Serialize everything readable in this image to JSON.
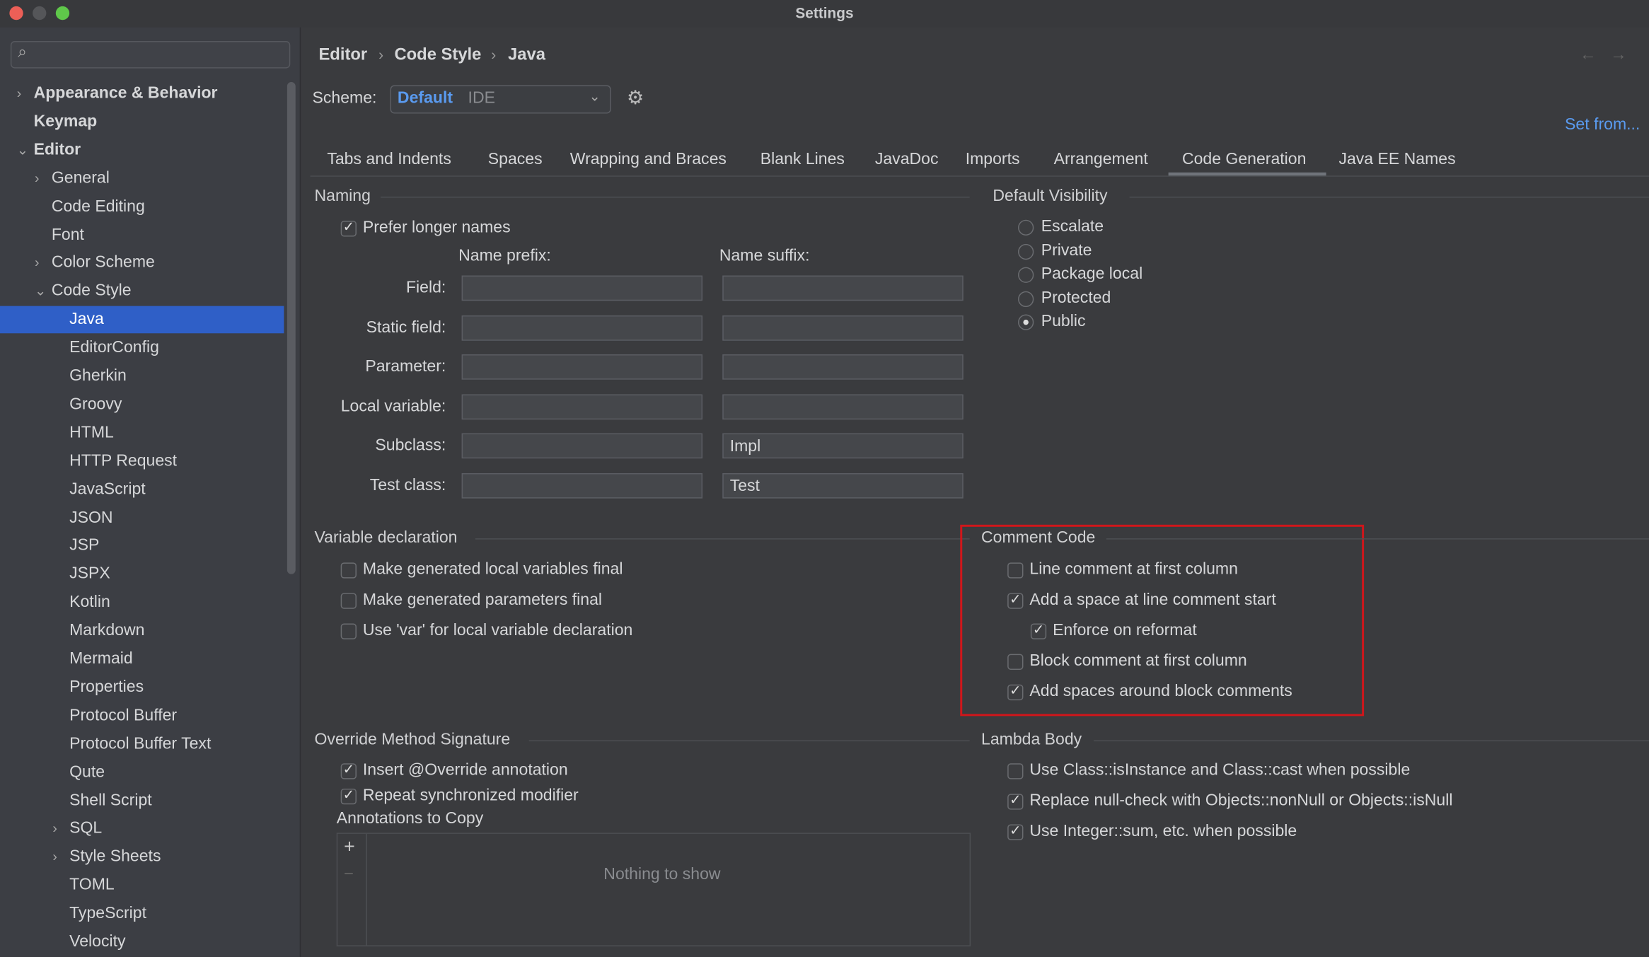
{
  "window": {
    "title": "Settings"
  },
  "search": {
    "placeholder": ""
  },
  "sidebar": {
    "items": [
      {
        "label": "Appearance & Behavior",
        "level": 0,
        "expander": "collapsed",
        "bold": true
      },
      {
        "label": "Keymap",
        "level": 0,
        "expander": "none",
        "bold": true
      },
      {
        "label": "Editor",
        "level": 0,
        "expander": "expanded",
        "bold": true
      },
      {
        "label": "General",
        "level": 1,
        "expander": "collapsed"
      },
      {
        "label": "Code Editing",
        "level": 1,
        "expander": "none"
      },
      {
        "label": "Font",
        "level": 1,
        "expander": "none"
      },
      {
        "label": "Color Scheme",
        "level": 1,
        "expander": "collapsed"
      },
      {
        "label": "Code Style",
        "level": 1,
        "expander": "expanded"
      },
      {
        "label": "Java",
        "level": 2,
        "expander": "none",
        "selected": true
      },
      {
        "label": "EditorConfig",
        "level": 2,
        "expander": "none"
      },
      {
        "label": "Gherkin",
        "level": 2,
        "expander": "none"
      },
      {
        "label": "Groovy",
        "level": 2,
        "expander": "none"
      },
      {
        "label": "HTML",
        "level": 2,
        "expander": "none"
      },
      {
        "label": "HTTP Request",
        "level": 2,
        "expander": "none"
      },
      {
        "label": "JavaScript",
        "level": 2,
        "expander": "none"
      },
      {
        "label": "JSON",
        "level": 2,
        "expander": "none"
      },
      {
        "label": "JSP",
        "level": 2,
        "expander": "none"
      },
      {
        "label": "JSPX",
        "level": 2,
        "expander": "none"
      },
      {
        "label": "Kotlin",
        "level": 2,
        "expander": "none"
      },
      {
        "label": "Markdown",
        "level": 2,
        "expander": "none"
      },
      {
        "label": "Mermaid",
        "level": 2,
        "expander": "none"
      },
      {
        "label": "Properties",
        "level": 2,
        "expander": "none"
      },
      {
        "label": "Protocol Buffer",
        "level": 2,
        "expander": "none"
      },
      {
        "label": "Protocol Buffer Text",
        "level": 2,
        "expander": "none"
      },
      {
        "label": "Qute",
        "level": 2,
        "expander": "none"
      },
      {
        "label": "Shell Script",
        "level": 2,
        "expander": "none"
      },
      {
        "label": "SQL",
        "level": 2,
        "expander": "collapsed"
      },
      {
        "label": "Style Sheets",
        "level": 2,
        "expander": "collapsed"
      },
      {
        "label": "TOML",
        "level": 2,
        "expander": "none"
      },
      {
        "label": "TypeScript",
        "level": 2,
        "expander": "none"
      },
      {
        "label": "Velocity",
        "level": 2,
        "expander": "none"
      }
    ]
  },
  "breadcrumb": [
    "Editor",
    "Code Style",
    "Java"
  ],
  "scheme": {
    "label": "Scheme:",
    "name": "Default",
    "kind": "IDE",
    "set_from": "Set from..."
  },
  "tabs": [
    {
      "label": "Tabs and Indents"
    },
    {
      "label": "Spaces"
    },
    {
      "label": "Wrapping and Braces"
    },
    {
      "label": "Blank Lines"
    },
    {
      "label": "JavaDoc"
    },
    {
      "label": "Imports"
    },
    {
      "label": "Arrangement"
    },
    {
      "label": "Code Generation",
      "active": true
    },
    {
      "label": "Java EE Names"
    }
  ],
  "naming": {
    "title": "Naming",
    "prefer_longer": {
      "label": "Prefer longer names",
      "checked": true
    },
    "prefix_header": "Name prefix:",
    "suffix_header": "Name suffix:",
    "rows": [
      {
        "label": "Field:",
        "prefix": "",
        "suffix": ""
      },
      {
        "label": "Static field:",
        "prefix": "",
        "suffix": ""
      },
      {
        "label": "Parameter:",
        "prefix": "",
        "suffix": ""
      },
      {
        "label": "Local variable:",
        "prefix": "",
        "suffix": ""
      },
      {
        "label": "Subclass:",
        "prefix": "",
        "suffix": "Impl"
      },
      {
        "label": "Test class:",
        "prefix": "",
        "suffix": "Test"
      }
    ]
  },
  "visibility": {
    "title": "Default Visibility",
    "options": [
      {
        "label": "Escalate",
        "selected": false
      },
      {
        "label": "Private",
        "selected": false
      },
      {
        "label": "Package local",
        "selected": false
      },
      {
        "label": "Protected",
        "selected": false
      },
      {
        "label": "Public",
        "selected": true
      }
    ]
  },
  "variable": {
    "title": "Variable declaration",
    "items": [
      {
        "label": "Make generated local variables final",
        "checked": false
      },
      {
        "label": "Make generated parameters final",
        "checked": false
      },
      {
        "label": "Use 'var' for local variable declaration",
        "checked": false
      }
    ]
  },
  "comment": {
    "title": "Comment Code",
    "highlight_color": "#d0161b",
    "items": [
      {
        "label": "Line comment at first column",
        "checked": false,
        "indent": 0
      },
      {
        "label": "Add a space at line comment start",
        "checked": true,
        "indent": 0
      },
      {
        "label": "Enforce on reformat",
        "checked": true,
        "indent": 1
      },
      {
        "label": "Block comment at first column",
        "checked": false,
        "indent": 0
      },
      {
        "label": "Add spaces around block comments",
        "checked": true,
        "indent": 0
      }
    ]
  },
  "override": {
    "title": "Override Method Signature",
    "items": [
      {
        "label": "Insert @Override annotation",
        "checked": true
      },
      {
        "label": "Repeat synchronized modifier",
        "checked": true
      }
    ],
    "annotations_label": "Annotations to Copy",
    "add": "+",
    "remove": "−",
    "empty": "Nothing to show"
  },
  "lambda": {
    "title": "Lambda Body",
    "items": [
      {
        "label": "Use Class::isInstance and Class::cast when possible",
        "checked": false
      },
      {
        "label": "Replace null-check with Objects::nonNull or Objects::isNull",
        "checked": true
      },
      {
        "label": "Use Integer::sum, etc. when possible",
        "checked": true
      }
    ]
  },
  "nav": {
    "back": "←",
    "forward": "→"
  },
  "colors": {
    "accent": "#2f5fc7",
    "link": "#5a9bf0"
  }
}
